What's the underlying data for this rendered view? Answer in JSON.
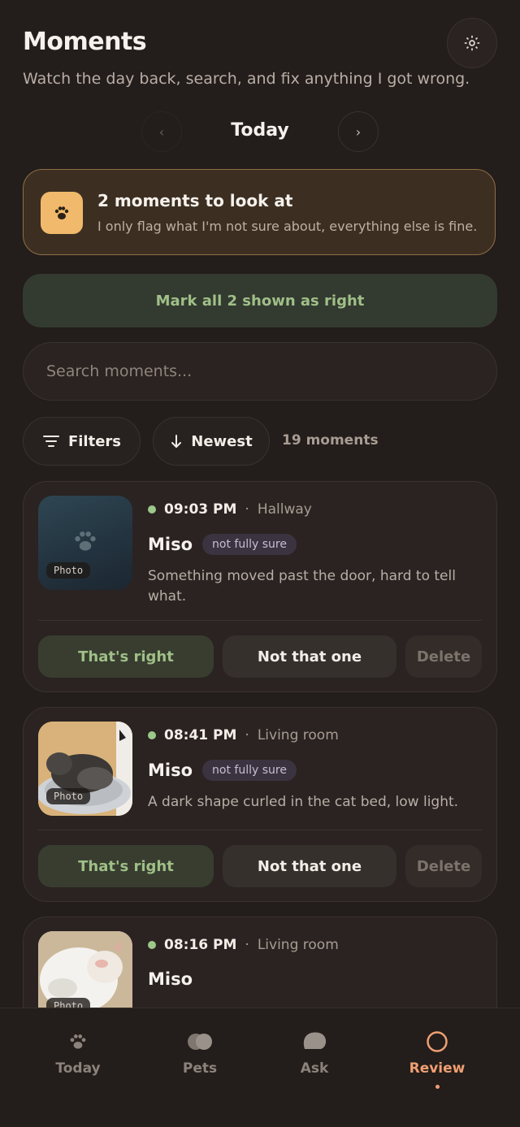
{
  "header": {
    "title": "Moments",
    "subtitle": "Watch the day back, search, and fix anything I got wrong."
  },
  "day_nav": {
    "prev": "‹",
    "label": "Today",
    "next": "›"
  },
  "alert": {
    "title": "2 moments to look at",
    "text": "I only flag what I'm not sure about, everything else is fine.",
    "icon": "paw-icon"
  },
  "mark_all_label": "Mark all 2 shown as right",
  "search": {
    "placeholder": "Search moments...",
    "value": ""
  },
  "toolbar": {
    "filters_label": "Filters",
    "sort_label": "Newest",
    "count": "19 moments"
  },
  "moments": [
    {
      "time": "09:03 PM",
      "location": "Hallway",
      "pet": "Miso",
      "badge": "not fully sure",
      "description": "Something moved past the door, hard to tell what.",
      "photo_tag": "Photo",
      "actions": {
        "right": "That's right",
        "wrong": "Not that one",
        "delete": "Delete"
      }
    },
    {
      "time": "08:41 PM",
      "location": "Living room",
      "pet": "Miso",
      "badge": "not fully sure",
      "description": "A dark shape curled in the cat bed, low light.",
      "photo_tag": "Photo",
      "actions": {
        "right": "That's right",
        "wrong": "Not that one",
        "delete": "Delete"
      }
    },
    {
      "time": "08:16 PM",
      "location": "Living room",
      "pet": "Miso",
      "photo_tag": "Photo"
    }
  ],
  "tabs": [
    {
      "label": "Today",
      "icon": "paw-icon"
    },
    {
      "label": "Pets",
      "icon": "pets-icon"
    },
    {
      "label": "Ask",
      "icon": "chat-bubble-icon"
    },
    {
      "label": "Review",
      "icon": "review-circle-icon",
      "active": true
    }
  ],
  "colors": {
    "background": "#231d1b",
    "accent": "#ef9f72",
    "confirm_green": "#9fbf87",
    "alert_orange": "#f0b96b"
  }
}
